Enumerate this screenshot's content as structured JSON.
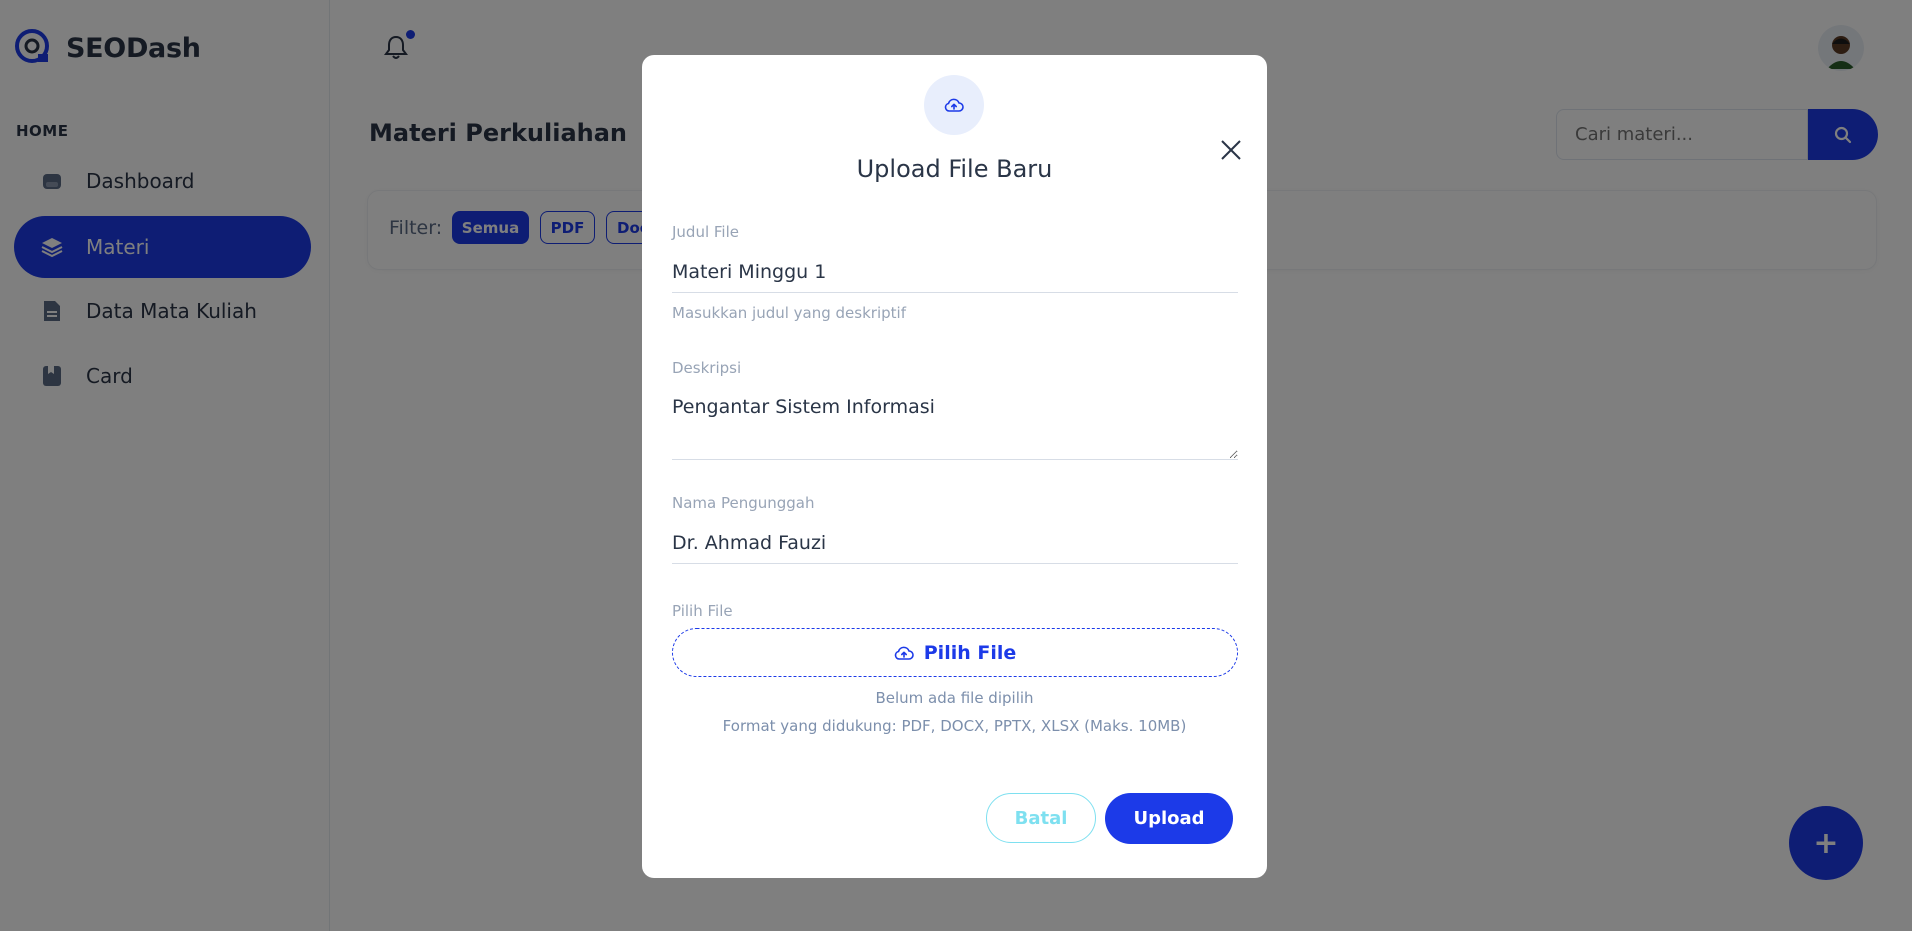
{
  "app": {
    "brand": "SEODash"
  },
  "sidebar": {
    "section": "HOME",
    "items": [
      {
        "label": "Dashboard",
        "icon": "dashboard-icon",
        "active": false
      },
      {
        "label": "Materi",
        "icon": "layers-icon",
        "active": true
      },
      {
        "label": "Data Mata Kuliah",
        "icon": "file-icon",
        "active": false
      },
      {
        "label": "Card",
        "icon": "bookmark-card-icon",
        "active": false
      }
    ]
  },
  "topbar": {
    "notification_icon": "bell-icon",
    "has_notification": true
  },
  "main": {
    "title": "Materi Perkuliahan",
    "search": {
      "placeholder": "Cari materi..."
    },
    "filter": {
      "label": "Filter:",
      "chips": [
        "Semua",
        "PDF",
        "Doc"
      ]
    },
    "fab_label": "+"
  },
  "modal": {
    "title": "Upload File Baru",
    "fields": {
      "judul": {
        "label": "Judul File",
        "value": "Materi Minggu 1",
        "help": "Masukkan judul yang deskriptif"
      },
      "deskripsi": {
        "label": "Deskripsi",
        "value": "Pengantar Sistem Informasi"
      },
      "pengunggah": {
        "label": "Nama Pengunggah",
        "value": "Dr. Ahmad Fauzi"
      },
      "file": {
        "label": "Pilih File",
        "button": "Pilih File",
        "status": "Belum ada file dipilih",
        "formats": "Format yang didukung: PDF, DOCX, PPTX, XLSX (Maks. 10MB)"
      }
    },
    "buttons": {
      "cancel": "Batal",
      "submit": "Upload"
    }
  },
  "colors": {
    "primary": "#1c3ae8",
    "cancel": "#7ee0f0",
    "text": "#2a3547",
    "muted": "#98a4b6"
  }
}
